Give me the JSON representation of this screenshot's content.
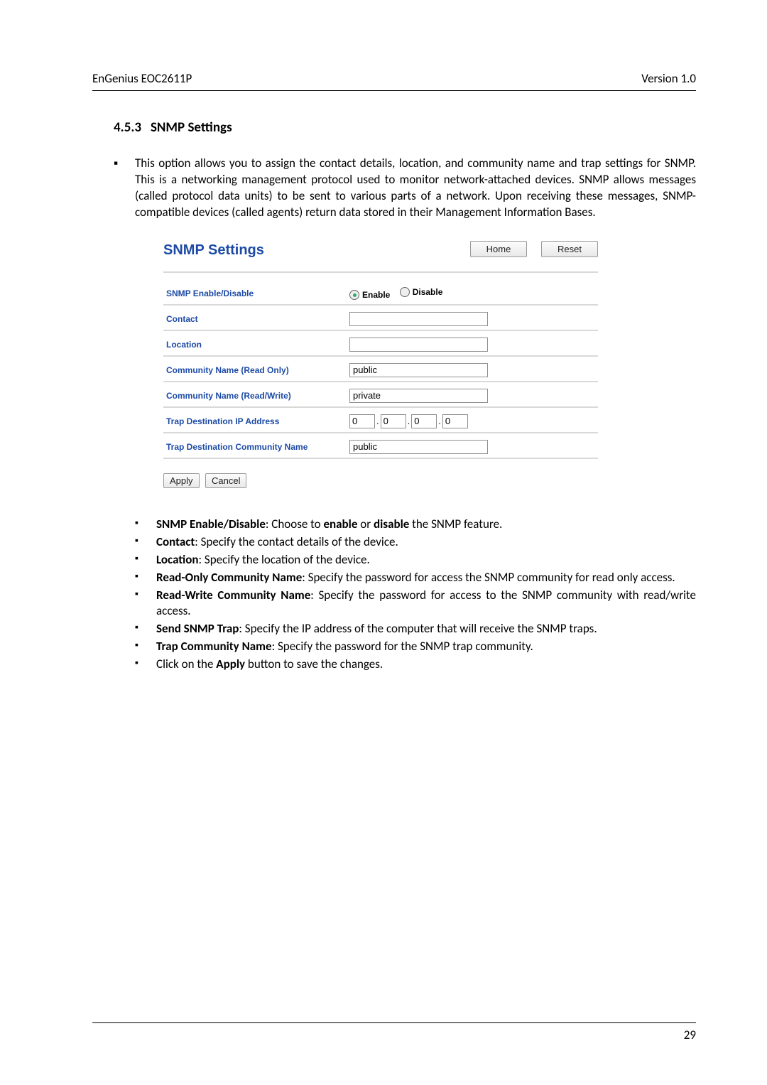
{
  "header": {
    "left": "EnGenius   EOC2611P",
    "right": "Version 1.0"
  },
  "section": {
    "number": "4.5.3",
    "title": "SNMP Settings"
  },
  "intro": "This option allows you to assign the contact details, location, and community name and trap settings for SNMP. This is a networking management protocol used to monitor network-attached devices. SNMP allows messages (called protocol data units) to be sent to various parts of a network. Upon receiving these messages, SNMP-compatible devices (called agents) return data stored in their Management Information Bases.",
  "screenshot": {
    "title": "SNMP Settings",
    "buttons": {
      "home": "Home",
      "reset": "Reset",
      "apply": "Apply",
      "cancel": "Cancel"
    },
    "rows": {
      "enable_label": "SNMP Enable/Disable",
      "enable_opt": "Enable",
      "disable_opt": "Disable",
      "contact_label": "Contact",
      "contact_value": "",
      "location_label": "Location",
      "location_value": "",
      "comm_ro_label": "Community Name (Read Only)",
      "comm_ro_value": "public",
      "comm_rw_label": "Community Name (Read/Write)",
      "comm_rw_value": "private",
      "trap_ip_label": "Trap Destination IP Address",
      "trap_ip": [
        "0",
        "0",
        "0",
        "0"
      ],
      "trap_comm_label": "Trap Destination Community Name",
      "trap_comm_value": "public"
    }
  },
  "descriptions": [
    {
      "bold": "SNMP Enable/Disable",
      "text": ": Choose to ",
      "bold2": "enable",
      "mid": " or ",
      "bold3": "disable",
      "rest": " the SNMP feature."
    },
    {
      "bold": "Contact",
      "rest": ": Specify the contact details of the device."
    },
    {
      "bold": "Location",
      "rest": ": Specify the location of the device."
    },
    {
      "bold": "Read-Only Community Name",
      "rest": ": Specify the password for access the SNMP community for read only access."
    },
    {
      "bold": "Read-Write Community Name",
      "rest": ": Specify the password for access to the SNMP community with read/write access."
    },
    {
      "bold": "Send SNMP Trap",
      "rest": ": Specify the IP address of the computer that will receive the SNMP traps."
    },
    {
      "bold": "Trap Community Name",
      "rest": ": Specify the password for the SNMP trap community."
    },
    {
      "plain_pre": "Click on the ",
      "bold": "Apply",
      "rest": " button to save the changes."
    }
  ],
  "footer": {
    "page": "29"
  }
}
